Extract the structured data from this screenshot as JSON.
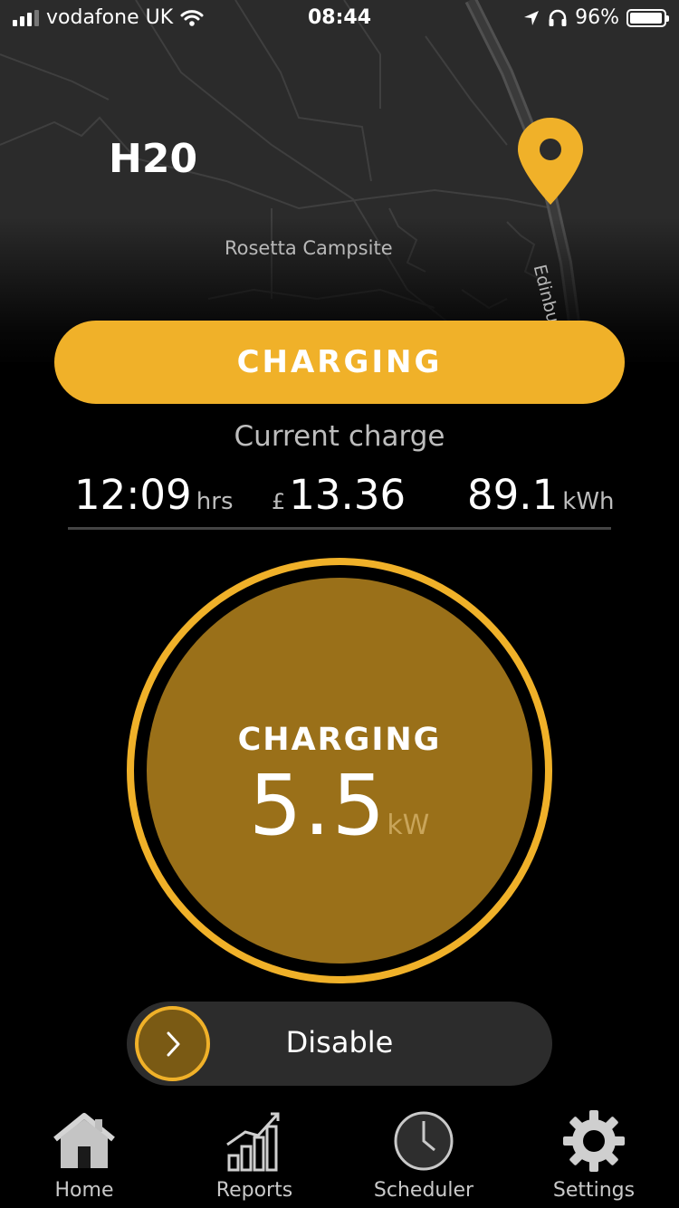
{
  "status_bar": {
    "carrier": "vodafone UK",
    "time": "08:44",
    "battery": "96%",
    "battery_level": 0.96
  },
  "map": {
    "site_name": "H20",
    "place_label": "Rosetta Campsite",
    "road_label": "Edinbur"
  },
  "status_pill": {
    "label": "CHARGING"
  },
  "current_charge": {
    "heading": "Current charge",
    "duration_value": "12:09",
    "duration_unit": "hrs",
    "currency_symbol": "£",
    "cost_value": "13.36",
    "energy_value": "89.1",
    "energy_unit": "kWh"
  },
  "gauge": {
    "status": "CHARGING",
    "power_value": "5.5",
    "power_unit": "kW"
  },
  "slider": {
    "label": "Disable"
  },
  "tabs": [
    {
      "label": "Home"
    },
    {
      "label": "Reports"
    },
    {
      "label": "Scheduler"
    },
    {
      "label": "Settings"
    }
  ],
  "colors": {
    "accent": "#f0b129",
    "gauge_fill": "#9a7019",
    "background": "#000000"
  }
}
